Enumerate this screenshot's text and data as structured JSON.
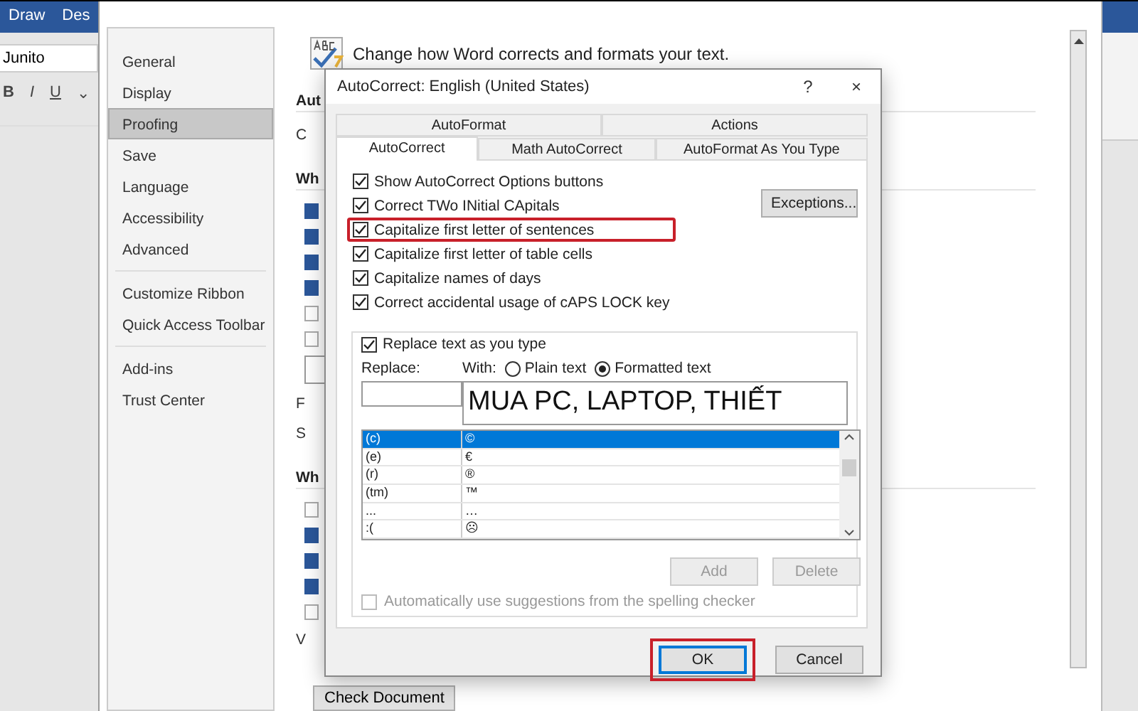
{
  "word": {
    "ribbon_tabs": [
      "Draw",
      "Des"
    ],
    "font_name": "Junito",
    "format_buttons": [
      "B",
      "I",
      "U",
      "⌄"
    ]
  },
  "options": {
    "header": "Change how Word corrects and formats your text.",
    "sidebar": [
      [
        {
          "label": "General",
          "selected": false
        },
        {
          "label": "Display",
          "selected": false
        },
        {
          "label": "Proofing",
          "selected": true
        },
        {
          "label": "Save",
          "selected": false
        },
        {
          "label": "Language",
          "selected": false
        },
        {
          "label": "Accessibility",
          "selected": false
        },
        {
          "label": "Advanced",
          "selected": false
        }
      ],
      [
        {
          "label": "Customize Ribbon",
          "selected": false
        },
        {
          "label": "Quick Access Toolbar",
          "selected": false
        }
      ],
      [
        {
          "label": "Add-ins",
          "selected": false
        },
        {
          "label": "Trust Center",
          "selected": false
        }
      ]
    ],
    "content": [
      {
        "kind": "heading",
        "text": "Aut"
      },
      {
        "kind": "text",
        "text": "C"
      },
      {
        "kind": "heading",
        "text": "Wh"
      },
      {
        "kind": "checkbox",
        "checked": true
      },
      {
        "kind": "checkbox",
        "checked": true
      },
      {
        "kind": "checkbox",
        "checked": true
      },
      {
        "kind": "checkbox",
        "checked": true
      },
      {
        "kind": "checkbox",
        "checked": false
      },
      {
        "kind": "checkbox",
        "checked": false
      },
      {
        "kind": "field"
      },
      {
        "kind": "text",
        "text": "F"
      },
      {
        "kind": "text",
        "text": "S"
      },
      {
        "kind": "heading",
        "text": "Wh"
      },
      {
        "kind": "checkbox",
        "checked": false
      },
      {
        "kind": "checkbox",
        "checked": true
      },
      {
        "kind": "checkbox",
        "checked": true
      },
      {
        "kind": "checkbox",
        "checked": true
      },
      {
        "kind": "checkbox",
        "checked": false
      },
      {
        "kind": "text",
        "text": "V"
      },
      {
        "kind": "button",
        "text": "Check Document"
      }
    ]
  },
  "dialog": {
    "title": "AutoCorrect: English (United States)",
    "help": "?",
    "close": "×",
    "tabs": [
      [
        {
          "label": "AutoFormat",
          "selected": false
        },
        {
          "label": "Actions",
          "selected": false
        }
      ],
      [
        {
          "label": "AutoCorrect",
          "selected": true
        },
        {
          "label": "Math AutoCorrect",
          "selected": false
        },
        {
          "label": "AutoFormat As You Type",
          "selected": false
        }
      ]
    ],
    "options": [
      {
        "label": "Show AutoCorrect Options buttons",
        "checked": true,
        "highlighted": false
      },
      {
        "label": "Correct TWo INitial CApitals",
        "checked": true,
        "highlighted": false
      },
      {
        "label": "Capitalize first letter of sentences",
        "checked": true,
        "highlighted": true
      },
      {
        "label": "Capitalize first letter of table cells",
        "checked": true,
        "highlighted": false
      },
      {
        "label": "Capitalize names of days",
        "checked": true,
        "highlighted": false
      },
      {
        "label": "Correct accidental usage of cAPS LOCK key",
        "checked": true,
        "highlighted": false
      }
    ],
    "exceptions_button": "Exceptions...",
    "replace_group": {
      "label": "Replace text as you type",
      "checked": true,
      "replace_label": "Replace:",
      "with_label": "With:",
      "radios": [
        {
          "label": "Plain text",
          "selected": false
        },
        {
          "label": "Formatted text",
          "selected": true
        }
      ],
      "with_value": "MUA PC, LAPTOP, THIẾT",
      "rows": [
        {
          "replace": "(c)",
          "with": "©",
          "selected": true
        },
        {
          "replace": "(e)",
          "with": "€",
          "selected": false
        },
        {
          "replace": "(r)",
          "with": "®",
          "selected": false
        },
        {
          "replace": "(tm)",
          "with": "™",
          "selected": false
        },
        {
          "replace": "...",
          "with": "…",
          "selected": false
        },
        {
          "replace": ":(",
          "with": "☹",
          "selected": false
        }
      ],
      "buttons": [
        {
          "label": "Add",
          "disabled": true
        },
        {
          "label": "Delete",
          "disabled": true
        }
      ],
      "suggestions": {
        "label": "Automatically use suggestions from the spelling checker",
        "checked": false,
        "disabled": true
      }
    },
    "footer": [
      {
        "label": "OK",
        "highlighted": true,
        "default": true
      },
      {
        "label": "Cancel",
        "highlighted": false,
        "default": false
      }
    ]
  }
}
